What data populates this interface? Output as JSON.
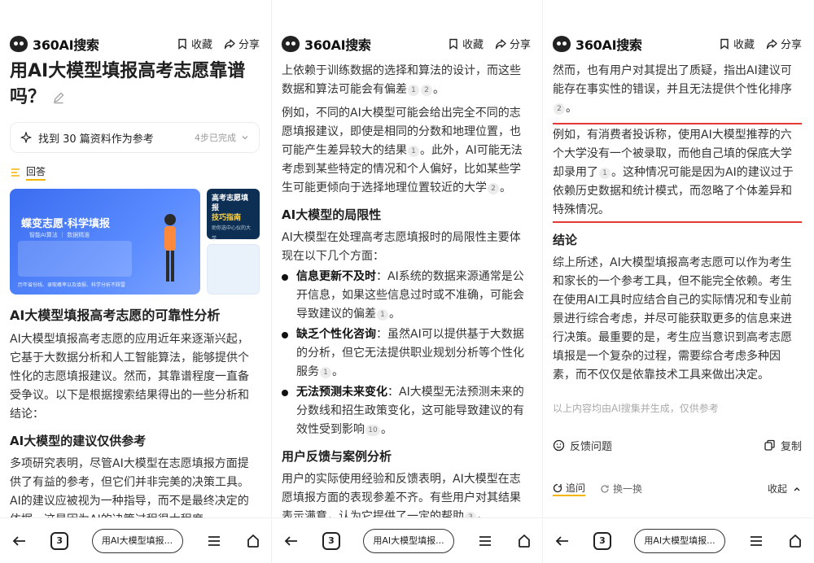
{
  "app": {
    "name": "360AI搜索",
    "collect": "收藏",
    "share": "分享"
  },
  "bottom": {
    "tab_count": "3",
    "tab_title": "用AI大模型填报..."
  },
  "phone1": {
    "question": "用AI大模型填报高考志愿靠谱吗？",
    "refs": "找到 30 篇资料作为参考",
    "steps": "4步已完成",
    "answer_tag": "回答",
    "card_main": {
      "title": "蝶变志愿·科学填报",
      "subtitle": "智能AI算法 ｜ 数据精准",
      "foot": "历年省份线、录取概率以及填报、科学分析不踩雷"
    },
    "card_side": {
      "line1": "高考志愿填报",
      "line2": "技巧指南",
      "mini": "助你选中心仪的大学"
    },
    "h_main": "AI大模型填报高考志愿的可靠性分析",
    "p_intro": "AI大模型填报高考志愿的应用近年来逐渐兴起，它基于大数据分析和人工智能算法，能够提供个性化的志愿填报建议。然而，其靠谱程度一直备受争议。以下是根据搜索结果得出的一些分析和结论：",
    "h_sub": "AI大模型的建议仅供参考",
    "p_sub": "多项研究表明，尽管AI大模型在志愿填报方面提供了有益的参考，但它们并非完美的决策工具。AI的建议应被视为一种指导，而不是最终决定的依据。这是因为AI的决策过程很大程度"
  },
  "phone2": {
    "p1": "上依赖于训练数据的选择和算法的设计，而这些数据和算法可能会有偏差",
    "p1_refs": [
      "1",
      "2"
    ],
    "p2": "例如，不同的AI大模型可能会给出完全不同的志愿填报建议，即使是相同的分数和地理位置，也可能产生差异较大的结果",
    "p2_ref": "1",
    "p2b": "。此外，AI可能无法考虑到某些特定的情况和个人偏好，比如某些学生可能更倾向于选择地理位置较近的大学",
    "p2b_ref": "2",
    "h_limit": "AI大模型的局限性",
    "p_limit": "AI大模型在处理高考志愿填报时的局限性主要体现在以下几个方面：",
    "bullets": [
      {
        "bold": "信息更新不及时",
        "text": "：AI系统的数据来源通常是公开信息，如果这些信息过时或不准确，可能会导致建议的偏差",
        "ref": "1"
      },
      {
        "bold": "缺乏个性化咨询",
        "text": "：虽然AI可以提供基于大数据的分析，但它无法提供职业规划分析等个性化服务",
        "ref": "1"
      },
      {
        "bold": "无法预测未来变化",
        "text": "：AI大模型无法预测未来的分数线和招生政策变化，这可能导致建议的有效性受到影响",
        "ref": "10"
      }
    ],
    "h_feedback": "用户反馈与案例分析",
    "p_feedback": "用户的实际使用经验和反馈表明，AI大模型在志愿填报方面的表现参差不齐。有些用户对其结果表示满意，认为它提供了一定的帮助",
    "p_feedback_ref": "3"
  },
  "phone3": {
    "p1": "然而，也有用户对其提出了质疑，指出AI建议可能存在事实性的错误，并且无法提供个性化排序",
    "p1_ref": "2",
    "p_hl": "例如，有消费者投诉称，使用AI大模型推荐的六个大学没有一个被录取，而他自己填的保底大学却录用了",
    "p_hl_ref": "1",
    "p_hl2": "。这种情况可能是因为AI的建议过于依赖历史数据和统计模式，而忽略了个体差异和特殊情况。",
    "h_conc": "结论",
    "p_conc": "综上所述，AI大模型填报高考志愿可以作为考生和家长的一个参考工具，但不能完全依赖。考生在使用AI工具时应结合自己的实际情况和专业前景进行综合考虑，并尽可能获取更多的信息来进行决策。最重要的是，考生应当意识到高考志愿填报是一个复杂的过程，需要综合考虑多种因素，而不仅仅是依靠技术工具来做出决定。",
    "disclaimer": "以上内容均由AI搜集并生成，仅供参考",
    "feedback": "反馈问题",
    "copy": "复制",
    "follow": "追问",
    "swap": "换一换",
    "collapse": "收起"
  },
  "colors": {
    "accent": "#f5b400",
    "highlight_border": "#e53935",
    "card_blue": "#3a6df0"
  }
}
